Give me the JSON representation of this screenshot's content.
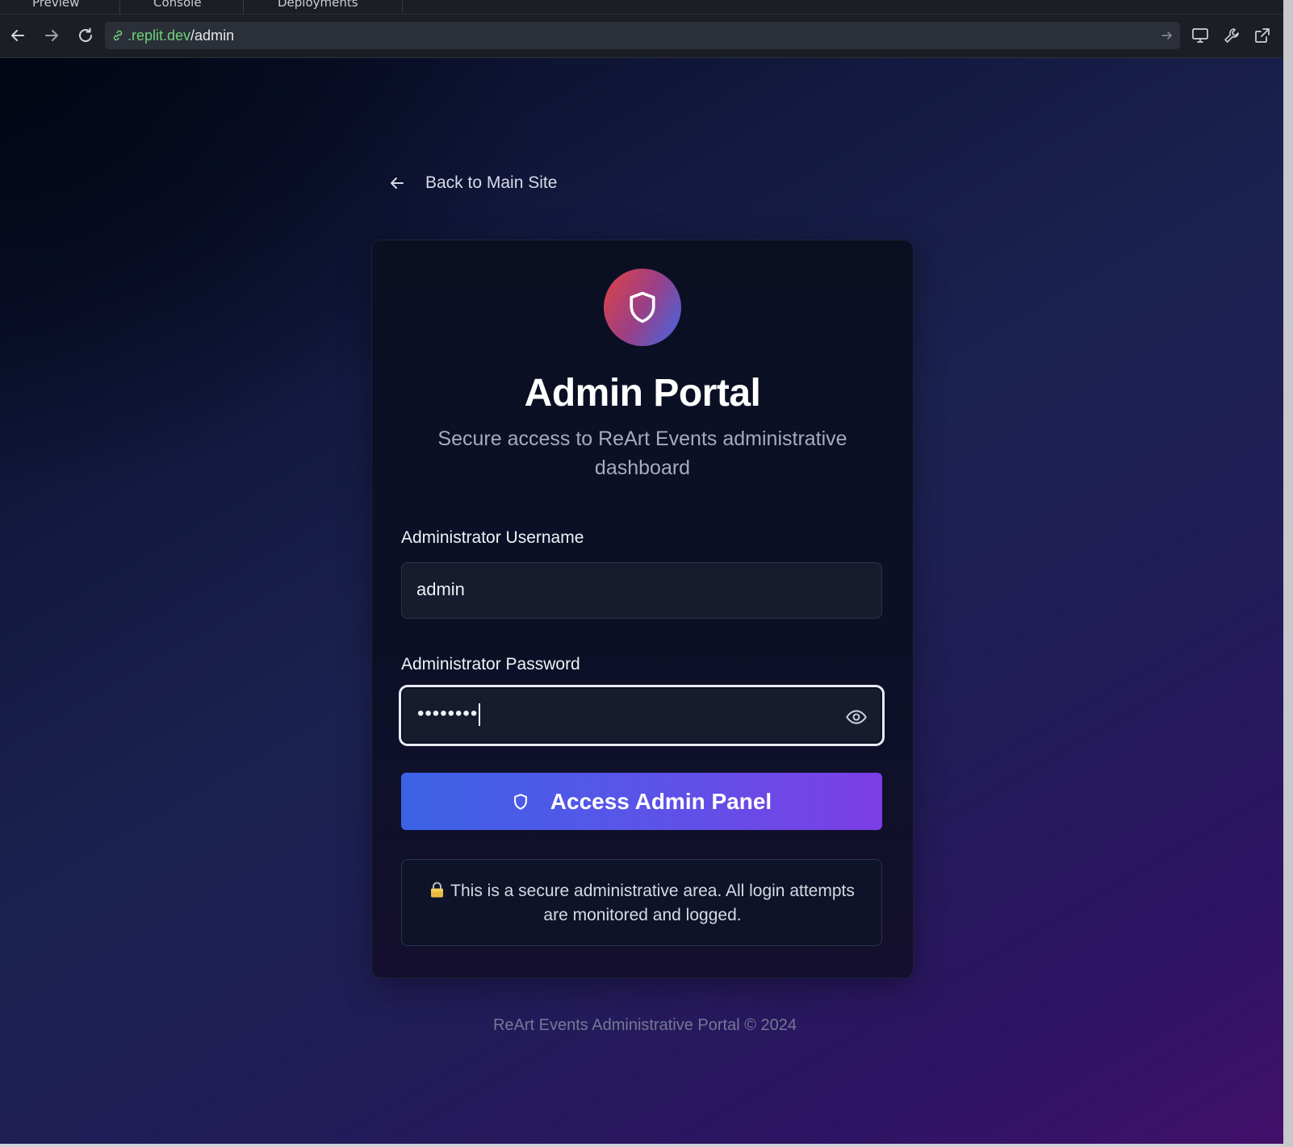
{
  "browser": {
    "tabs": [
      {
        "label": "Preview"
      },
      {
        "label": "Console"
      },
      {
        "label": "Deployments"
      }
    ],
    "url_host": ".replit.dev",
    "url_path": "/admin"
  },
  "page": {
    "back_link": "Back to Main Site",
    "title": "Admin Portal",
    "subtitle": "Secure access to ReArt Events administrative dashboard",
    "username_label": "Administrator Username",
    "username_value": "admin",
    "password_label": "Administrator Password",
    "password_value": "••••••••",
    "submit_label": "Access Admin Panel",
    "notice": "This is a secure administrative area. All login attempts are monitored and logged.",
    "footer": "ReArt Events Administrative Portal © 2024"
  },
  "icons": {
    "badge": "shield-icon",
    "back": "arrow-left-icon",
    "password_toggle": "eye-icon",
    "submit": "shield-icon",
    "notice": "lock-icon"
  },
  "colors": {
    "accent_start": "#3b63e6",
    "accent_end": "#7c3ee6",
    "badge_start": "#e04343",
    "badge_end": "#3f67e6",
    "url_host": "#6fd37c"
  }
}
